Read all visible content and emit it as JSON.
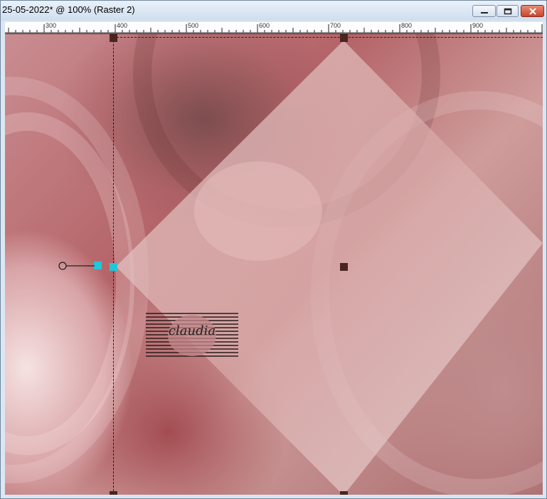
{
  "window": {
    "title": "25-05-2022* @ 100% (Raster 2)",
    "controls": {
      "minimize": "minimize",
      "maximize": "maximize",
      "close": "close"
    }
  },
  "ruler": {
    "labels": [
      "300",
      "400",
      "500",
      "600",
      "700",
      "800",
      "900"
    ]
  },
  "canvas": {
    "watermark_text": "claudia",
    "colors": {
      "accent_handle": "#22c6d8",
      "handle": "#4a2420",
      "background_base": "#b46468"
    }
  },
  "icons": {
    "rotate_handle": "rotation-handle-icon",
    "pick_tool_handles": "transform-handle-icon"
  }
}
